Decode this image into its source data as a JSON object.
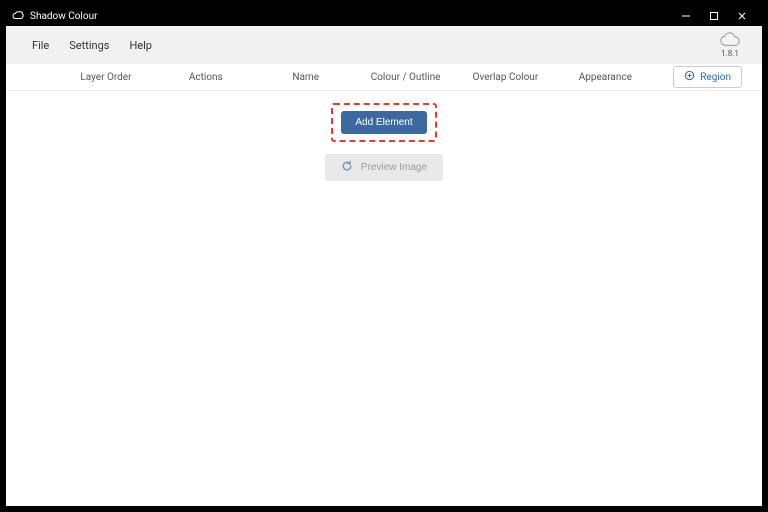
{
  "app": {
    "title": "Shadow Colour",
    "version": "1.8.1"
  },
  "window_controls": {
    "minimize": "min",
    "maximize": "max",
    "close": "close"
  },
  "menu": {
    "file": "File",
    "settings": "Settings",
    "help": "Help"
  },
  "columns": {
    "layer_order": "Layer Order",
    "actions": "Actions",
    "name": "Name",
    "colour_outline": "Colour / Outline",
    "overlap_colour": "Overlap Colour",
    "appearance": "Appearance"
  },
  "buttons": {
    "region": "Region",
    "add_element": "Add Element",
    "preview_image": "Preview Image"
  }
}
